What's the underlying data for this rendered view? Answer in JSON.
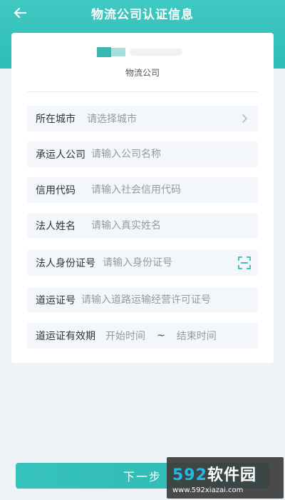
{
  "header": {
    "title": "物流公司认证信息"
  },
  "company": {
    "type_label": "物流公司"
  },
  "form": {
    "rows": [
      {
        "label": "所在城市",
        "placeholder": "请选择城市"
      },
      {
        "label": "承运人公司",
        "placeholder": "请输入公司名称"
      },
      {
        "label": "信用代码",
        "placeholder": "请输入社会信用代码"
      },
      {
        "label": "法人姓名",
        "placeholder": "请输入真实姓名"
      },
      {
        "label": "法人身份证号",
        "placeholder": "请输入身份证号"
      },
      {
        "label": "道运证号",
        "placeholder": "请输入道路运输经营许可证号"
      },
      {
        "label": "道运证有效期",
        "start_placeholder": "开始时间",
        "separator": "~",
        "end_placeholder": "结束时间"
      }
    ]
  },
  "footer": {
    "next_label": "下一步"
  },
  "watermark": {
    "brand_num": "592",
    "brand_text": "软件园",
    "url": "www.592xiazai.com"
  },
  "colors": {
    "primary": "#2fbdb5",
    "field_bg": "#f3f6fa",
    "page_bg": "#eef3f8"
  },
  "icons": {
    "back": "arrow-left-icon",
    "chevron": "chevron-right-icon",
    "scan": "scan-icon"
  }
}
